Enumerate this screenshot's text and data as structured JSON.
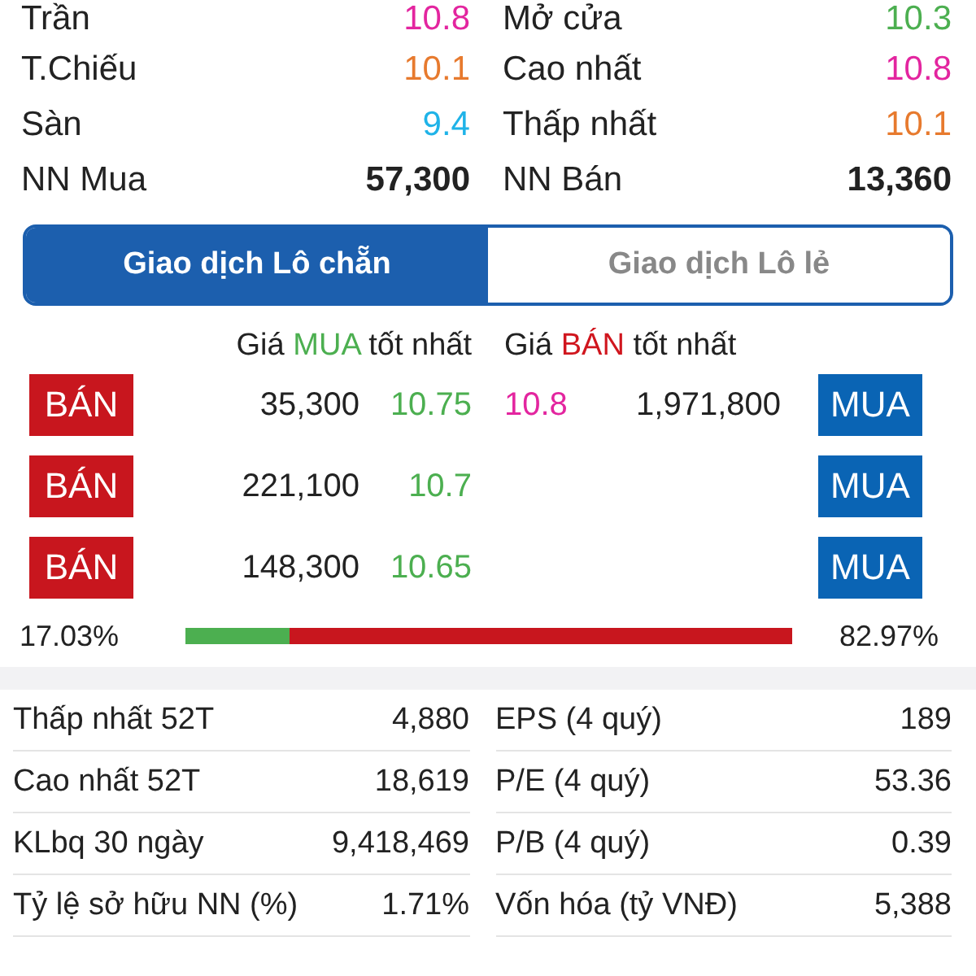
{
  "quotes": [
    {
      "label": "Trần",
      "value": "10.8",
      "color": "#e3259f"
    },
    {
      "label": "Mở cửa",
      "value": "10.3",
      "color": "#4caf50"
    },
    {
      "label": "T.Chiếu",
      "value": "10.1",
      "color": "#e77a2e"
    },
    {
      "label": "Cao nhất",
      "value": "10.8",
      "color": "#e3259f"
    },
    {
      "label": "Sàn",
      "value": "9.4",
      "color": "#1fb3e8"
    },
    {
      "label": "Thấp nhất",
      "value": "10.1",
      "color": "#e77a2e"
    },
    {
      "label": "NN Mua",
      "value": "57,300",
      "color": "#222222"
    },
    {
      "label": "NN Bán",
      "value": "13,360",
      "color": "#222222"
    }
  ],
  "tabs": [
    {
      "label": "Giao dịch Lô chẵn",
      "selected": true
    },
    {
      "label": "Giao dịch Lô lẻ",
      "selected": false
    }
  ],
  "order_book": {
    "bid_header": {
      "prefix": "Giá",
      "highlight": "MUA",
      "suffix": "tốt nhất"
    },
    "ask_header": {
      "prefix": "Giá",
      "highlight": "BÁN",
      "suffix": "tốt nhất"
    },
    "rows": [
      {
        "sell_button": "BÁN",
        "bid_volume": "35,300",
        "bid_price": "10.75",
        "ask_price": "10.8",
        "ask_volume": "1,971,800",
        "buy_button": "MUA"
      },
      {
        "sell_button": "BÁN",
        "bid_volume": "221,100",
        "bid_price": "10.7",
        "buy_button": "MUA"
      },
      {
        "sell_button": "BÁN",
        "bid_volume": "148,300",
        "bid_price": "10.65",
        "buy_button": "MUA"
      }
    ],
    "buy_share": "17.03%",
    "level": 0.1703,
    "sell_share": "82.97%"
  },
  "stats": [
    {
      "label": "Thấp nhất 52T",
      "value": "4,880"
    },
    {
      "label": "EPS (4 quý)",
      "value": "189"
    },
    {
      "label": "Cao nhất 52T",
      "value": "18,619"
    },
    {
      "label": "P/E (4 quý)",
      "value": "53.36"
    },
    {
      "label": "KLbq 30 ngày",
      "value": "9,418,469"
    },
    {
      "label": "P/B (4 quý)",
      "value": "0.39"
    },
    {
      "label": "Tỷ lệ sở hữu NN (%)",
      "value": "1.71%"
    },
    {
      "label": "Vốn hóa (tỷ VNĐ)",
      "value": "5,388"
    }
  ]
}
